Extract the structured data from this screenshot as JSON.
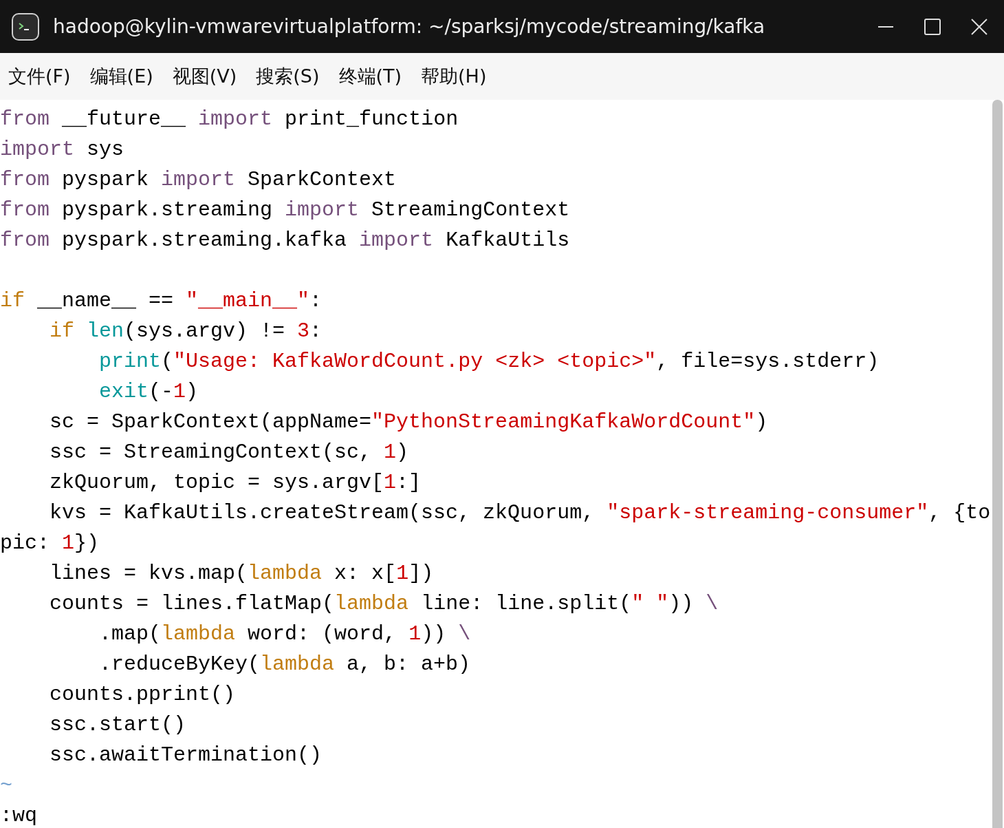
{
  "window": {
    "title": "hadoop@kylin-vmwarevirtualplatform: ~/sparksj/mycode/streaming/kafka"
  },
  "menu": [
    "文件(F)",
    "编辑(E)",
    "视图(V)",
    "搜索(S)",
    "终端(T)",
    "帮助(H)"
  ],
  "editor": {
    "lines": [
      {
        "kind": "code",
        "tokens": [
          {
            "kind": "import",
            "text": "from"
          },
          {
            "kind": "plain",
            "text": " __future__ "
          },
          {
            "kind": "import",
            "text": "import"
          },
          {
            "kind": "plain",
            "text": " print_function"
          }
        ]
      },
      {
        "kind": "code",
        "tokens": [
          {
            "kind": "import",
            "text": "import"
          },
          {
            "kind": "plain",
            "text": " sys"
          }
        ]
      },
      {
        "kind": "code",
        "tokens": [
          {
            "kind": "import",
            "text": "from"
          },
          {
            "kind": "plain",
            "text": " pyspark "
          },
          {
            "kind": "import",
            "text": "import"
          },
          {
            "kind": "plain",
            "text": " SparkContext"
          }
        ]
      },
      {
        "kind": "code",
        "tokens": [
          {
            "kind": "import",
            "text": "from"
          },
          {
            "kind": "plain",
            "text": " pyspark.streaming "
          },
          {
            "kind": "import",
            "text": "import"
          },
          {
            "kind": "plain",
            "text": " StreamingContext"
          }
        ]
      },
      {
        "kind": "code",
        "tokens": [
          {
            "kind": "import",
            "text": "from"
          },
          {
            "kind": "plain",
            "text": " pyspark.streaming.kafka "
          },
          {
            "kind": "import",
            "text": "import"
          },
          {
            "kind": "plain",
            "text": " KafkaUtils"
          }
        ]
      },
      {
        "kind": "blank"
      },
      {
        "kind": "code",
        "tokens": [
          {
            "kind": "control",
            "text": "if"
          },
          {
            "kind": "plain",
            "text": " __name__ == "
          },
          {
            "kind": "string",
            "text": "\"__main__\""
          },
          {
            "kind": "plain",
            "text": ":"
          }
        ]
      },
      {
        "kind": "code",
        "tokens": [
          {
            "kind": "control",
            "text": "    if "
          },
          {
            "kind": "builtin",
            "text": "len"
          },
          {
            "kind": "plain",
            "text": "(sys.argv) != "
          },
          {
            "kind": "number",
            "text": "3"
          },
          {
            "kind": "plain",
            "text": ":"
          }
        ]
      },
      {
        "kind": "code",
        "tokens": [
          {
            "kind": "builtin",
            "text": "        print"
          },
          {
            "kind": "plain",
            "text": "("
          },
          {
            "kind": "string",
            "text": "\"Usage: KafkaWordCount.py <zk> <topic>\""
          },
          {
            "kind": "plain",
            "text": ", file=sys.stderr)"
          }
        ]
      },
      {
        "kind": "code",
        "tokens": [
          {
            "kind": "builtin",
            "text": "        exit"
          },
          {
            "kind": "plain",
            "text": "(-"
          },
          {
            "kind": "number",
            "text": "1"
          },
          {
            "kind": "plain",
            "text": ")"
          }
        ]
      },
      {
        "kind": "code",
        "tokens": [
          {
            "kind": "plain",
            "text": "    sc = SparkContext(appName="
          },
          {
            "kind": "string",
            "text": "\"PythonStreamingKafkaWordCount\""
          },
          {
            "kind": "plain",
            "text": ")"
          }
        ]
      },
      {
        "kind": "code",
        "tokens": [
          {
            "kind": "plain",
            "text": "    ssc = StreamingContext(sc, "
          },
          {
            "kind": "number",
            "text": "1"
          },
          {
            "kind": "plain",
            "text": ")"
          }
        ]
      },
      {
        "kind": "code",
        "tokens": [
          {
            "kind": "plain",
            "text": "    zkQuorum, topic = sys.argv["
          },
          {
            "kind": "number",
            "text": "1"
          },
          {
            "kind": "plain",
            "text": ":]"
          }
        ]
      },
      {
        "kind": "code",
        "tokens": [
          {
            "kind": "plain",
            "text": "    kvs = KafkaUtils.createStream(ssc, zkQuorum, "
          },
          {
            "kind": "string",
            "text": "\"spark-streaming-consumer\""
          },
          {
            "kind": "plain",
            "text": ", {to"
          }
        ]
      },
      {
        "kind": "code",
        "tokens": [
          {
            "kind": "plain",
            "text": "pic: "
          },
          {
            "kind": "number",
            "text": "1"
          },
          {
            "kind": "plain",
            "text": "})"
          }
        ]
      },
      {
        "kind": "code",
        "tokens": [
          {
            "kind": "plain",
            "text": "    lines = kvs.map("
          },
          {
            "kind": "control",
            "text": "lambda"
          },
          {
            "kind": "plain",
            "text": " x: x["
          },
          {
            "kind": "number",
            "text": "1"
          },
          {
            "kind": "plain",
            "text": "])"
          }
        ]
      },
      {
        "kind": "code",
        "tokens": [
          {
            "kind": "plain",
            "text": "    counts = lines.flatMap("
          },
          {
            "kind": "control",
            "text": "lambda"
          },
          {
            "kind": "plain",
            "text": " line: line.split("
          },
          {
            "kind": "string",
            "text": "\" \""
          },
          {
            "kind": "plain",
            "text": ")) "
          },
          {
            "kind": "special",
            "text": "\\"
          }
        ]
      },
      {
        "kind": "code",
        "tokens": [
          {
            "kind": "plain",
            "text": "        .map("
          },
          {
            "kind": "control",
            "text": "lambda"
          },
          {
            "kind": "plain",
            "text": " word: (word, "
          },
          {
            "kind": "number",
            "text": "1"
          },
          {
            "kind": "plain",
            "text": ")) "
          },
          {
            "kind": "special",
            "text": "\\"
          }
        ]
      },
      {
        "kind": "code",
        "tokens": [
          {
            "kind": "plain",
            "text": "        .reduceByKey("
          },
          {
            "kind": "control",
            "text": "lambda"
          },
          {
            "kind": "plain",
            "text": " a, b: a+b)"
          }
        ]
      },
      {
        "kind": "code",
        "tokens": [
          {
            "kind": "plain",
            "text": "    counts.pprint()"
          }
        ]
      },
      {
        "kind": "code",
        "tokens": [
          {
            "kind": "plain",
            "text": "    ssc.start()"
          }
        ]
      },
      {
        "kind": "code",
        "tokens": [
          {
            "kind": "plain",
            "text": "    ssc.awaitTermination()"
          }
        ]
      },
      {
        "kind": "tilde",
        "text": "~"
      }
    ],
    "command": ":wq"
  }
}
